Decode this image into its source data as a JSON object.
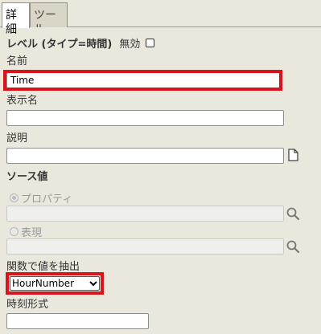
{
  "tabs": [
    {
      "label": "詳細"
    },
    {
      "label": "ツール"
    }
  ],
  "level": {
    "title": "レベル (タイプ=時間)",
    "disabled_label": "無効",
    "disabled_checked": false
  },
  "fields": {
    "name": {
      "label": "名前",
      "value": "Time"
    },
    "display_name": {
      "label": "表示名",
      "value": ""
    },
    "description": {
      "label": "説明",
      "value": ""
    }
  },
  "source": {
    "title": "ソース値",
    "property_label": "プロパティ",
    "property_value": "",
    "expression_label": "表現",
    "expression_value": ""
  },
  "extract": {
    "label": "関数で値を抽出",
    "selected": "HourNumber"
  },
  "time_format": {
    "label": "時刻形式",
    "value": ""
  },
  "colors": {
    "highlight": "#d9141b",
    "background": "#eae8dc"
  },
  "icons": [
    "document-icon",
    "search-icon",
    "chevron-down-icon"
  ]
}
